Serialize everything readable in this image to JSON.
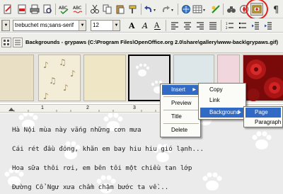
{
  "toolbar": {
    "font_name": "trebuchet ms;sans-serif",
    "font_size": "12"
  },
  "gallery": {
    "title": "Backgrounds - grypaws (C:\\Program Files\\OpenOffice.org 2.0\\share\\gallery\\www-back\\grypaws.gif)"
  },
  "ruler": {
    "marks": [
      "1",
      "2",
      "3"
    ]
  },
  "context_menu": {
    "items": [
      "Insert",
      "Preview",
      "Title",
      "Delete"
    ]
  },
  "insert_submenu": {
    "items": [
      "Copy",
      "Link",
      "Background"
    ]
  },
  "background_submenu": {
    "items": [
      "Page",
      "Paragraph"
    ]
  },
  "document": {
    "lines": [
      "Hà Nội mùa này vắng những cơn mưa",
      "Cái rét đầu đông, khăn em bay hiu hiu gió lạnh...",
      "Hoa sữa thôi rơi, em bên tôi một chiều tan lớp",
      "Đường Cổ Ngư xưa chầm chậm bước ta về..."
    ]
  },
  "colors": {
    "highlight": "#316ac5",
    "annotation_circle": "#e0201c",
    "toolbar_bg": "#eeeeea"
  }
}
